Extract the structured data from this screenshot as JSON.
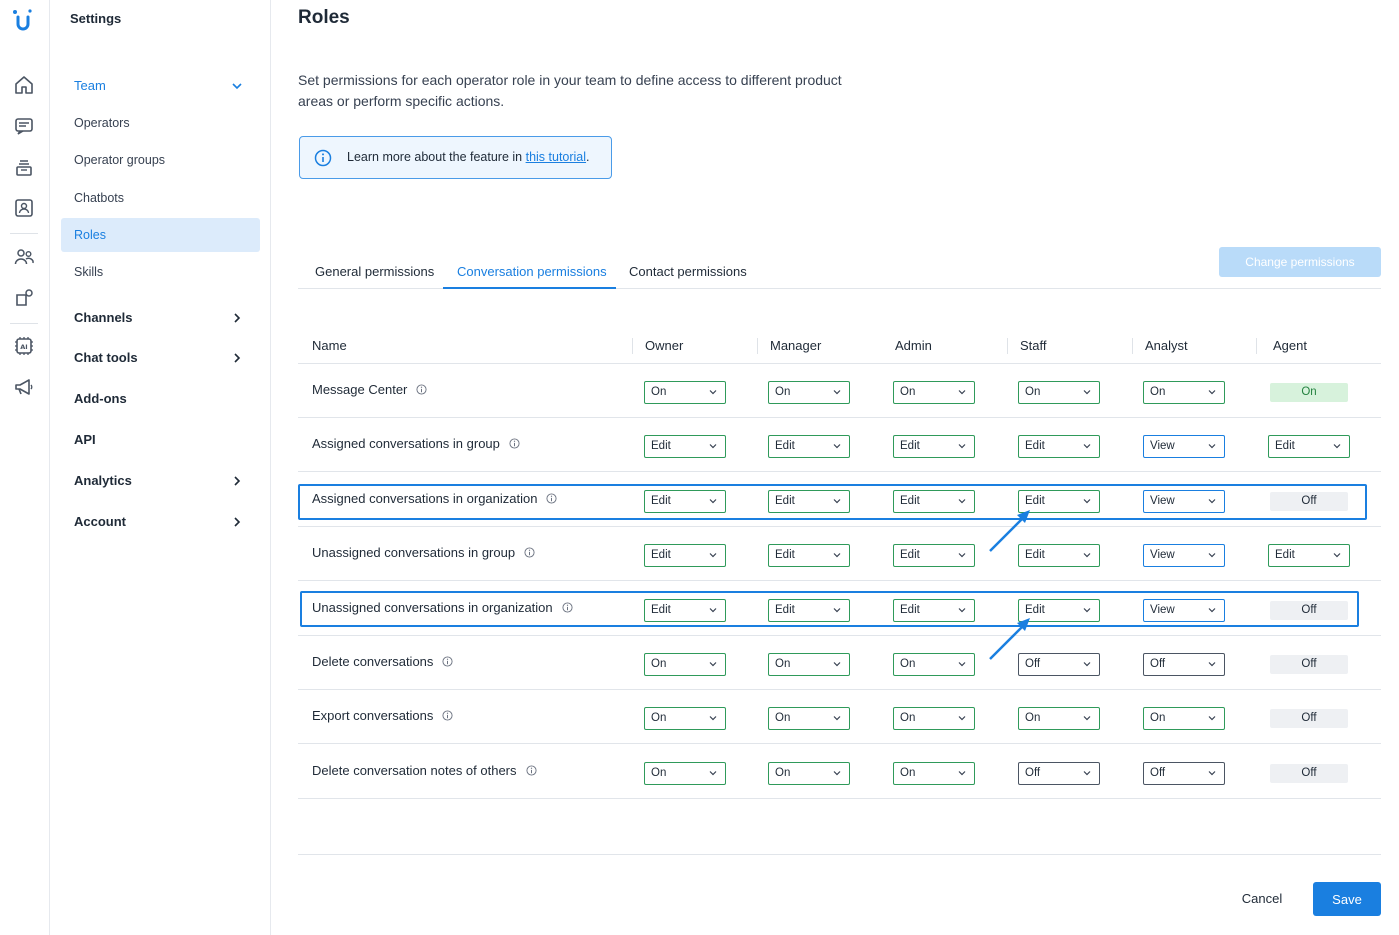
{
  "sidebar": {
    "title": "Settings",
    "team": "Team",
    "operators": "Operators",
    "operator_groups": "Operator groups",
    "chatbots": "Chatbots",
    "roles": "Roles",
    "skills": "Skills",
    "channels": "Channels",
    "chat_tools": "Chat tools",
    "addons": "Add-ons",
    "api": "API",
    "analytics": "Analytics",
    "account": "Account"
  },
  "rail_icons": [
    "home-icon",
    "chat-icon",
    "inbox-icon",
    "contacts-icon",
    "team-icon",
    "integrations-icon",
    "ai-icon",
    "megaphone-icon"
  ],
  "page": {
    "title": "Roles",
    "description": "Set permissions for each operator role in your team to define access to different product areas or perform specific actions.",
    "info_text": "Learn more about the feature in ",
    "info_link": "this tutorial",
    "info_suffix": ".",
    "change_permissions": "Change permissions"
  },
  "tabs": [
    "General permissions",
    "Conversation permissions",
    "Contact permissions"
  ],
  "active_tab": 1,
  "columns": [
    "Name",
    "Owner",
    "Manager",
    "Admin",
    "Staff",
    "Analyst",
    "Agent"
  ],
  "rows": [
    {
      "name": "Message Center",
      "values": [
        "On",
        "On",
        "On",
        "On",
        "On",
        "On"
      ]
    },
    {
      "name": "Assigned conversations in group",
      "values": [
        "Edit",
        "Edit",
        "Edit",
        "Edit",
        "View",
        "Edit"
      ]
    },
    {
      "name": "Assigned conversations in organization",
      "values": [
        "Edit",
        "Edit",
        "Edit",
        "Edit",
        "View",
        "Off"
      ]
    },
    {
      "name": "Unassigned conversations in group",
      "values": [
        "Edit",
        "Edit",
        "Edit",
        "Edit",
        "View",
        "Edit"
      ]
    },
    {
      "name": "Unassigned conversations in organization",
      "values": [
        "Edit",
        "Edit",
        "Edit",
        "Edit",
        "View",
        "Off"
      ]
    },
    {
      "name": "Delete conversations",
      "values": [
        "On",
        "On",
        "On",
        "Off",
        "Off",
        "Off"
      ]
    },
    {
      "name": "Export conversations",
      "values": [
        "On",
        "On",
        "On",
        "On",
        "On",
        "Off"
      ]
    },
    {
      "name": "Delete conversation notes of others",
      "values": [
        "On",
        "On",
        "On",
        "Off",
        "Off",
        "Off"
      ]
    }
  ],
  "footer": {
    "cancel": "Cancel",
    "save": "Save"
  },
  "colors": {
    "accent": "#1a7fe0",
    "green": "#2f9a5a",
    "highlight": "#1a7fe0"
  }
}
